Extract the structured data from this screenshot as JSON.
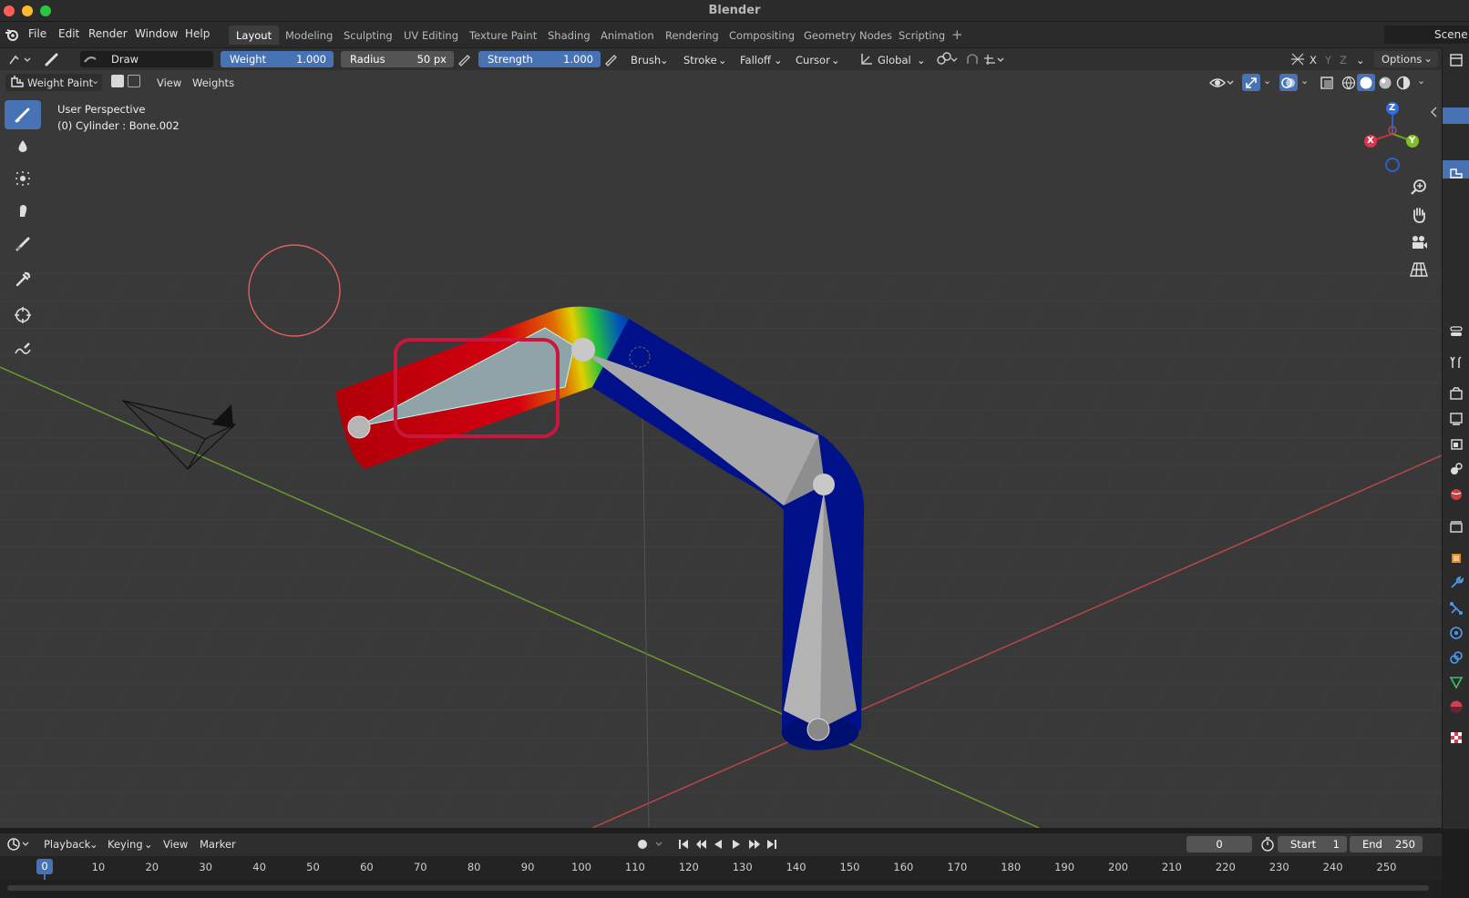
{
  "window": {
    "title": "Blender"
  },
  "menu": {
    "items": [
      "File",
      "Edit",
      "Render",
      "Window",
      "Help"
    ]
  },
  "workspaces": {
    "tabs": [
      "Layout",
      "Modeling",
      "Sculpting",
      "UV Editing",
      "Texture Paint",
      "Shading",
      "Animation",
      "Rendering",
      "Compositing",
      "Geometry Nodes",
      "Scripting"
    ],
    "active": "Layout",
    "add_label": "+"
  },
  "scene": {
    "label": "Scene"
  },
  "tool_header": {
    "brush_name": "Draw",
    "weight": {
      "label": "Weight",
      "value": "1.000"
    },
    "radius": {
      "label": "Radius",
      "value": "50 px"
    },
    "strength": {
      "label": "Strength",
      "value": "1.000"
    },
    "dropdowns": [
      "Brush",
      "Stroke",
      "Falloff",
      "Cursor"
    ],
    "orientation": "Global",
    "options_label": "Options",
    "axes": [
      "X",
      "Y",
      "Z"
    ]
  },
  "viewport_header": {
    "mode": "Weight Paint",
    "menus": [
      "View",
      "Weights"
    ]
  },
  "viewport": {
    "perspective": "User Perspective",
    "object_info": "(0) Cylinder : Bone.002",
    "gizmo": {
      "x": "X",
      "y": "Y",
      "z": "Z"
    }
  },
  "toolbar": {
    "tools": [
      "draw-brush",
      "blur-brush",
      "average-brush",
      "smear-brush",
      "gradient-tool",
      "sample-weight-tool",
      "cursor-tool",
      "annotate-tool"
    ],
    "active": "draw-brush"
  },
  "timeline": {
    "menus": [
      "Playback",
      "Keying",
      "View",
      "Marker"
    ],
    "current_frame": "0",
    "start_label": "Start",
    "start_value": "1",
    "end_label": "End",
    "end_value": "250",
    "playhead_label": "0",
    "ticks": [
      "10",
      "20",
      "30",
      "40",
      "50",
      "60",
      "70",
      "80",
      "90",
      "100",
      "110",
      "120",
      "130",
      "140",
      "150",
      "160",
      "170",
      "180",
      "190",
      "200",
      "210",
      "220",
      "230",
      "240",
      "250"
    ]
  },
  "colors": {
    "accent": "#4772b3",
    "viewport_bg": "#393939",
    "highlight_box": "#c8173f",
    "brush_cursor": "#e06060",
    "x_axis": "#b84747",
    "y_axis": "#6a9a2a"
  }
}
